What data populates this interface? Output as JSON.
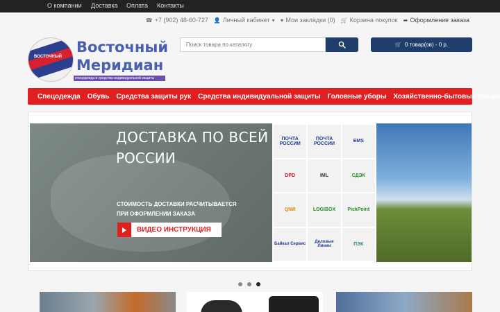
{
  "top_nav": {
    "items": [
      "О компании",
      "Доставка",
      "Оплата",
      "Контакты"
    ]
  },
  "utility": {
    "phone": "+7 (902) 48-60-727",
    "account": "Личный кабинет",
    "bookmarks": "Мои закладки (0)",
    "cart": "Корзина покупок",
    "checkout": "Оформление заказа"
  },
  "logo": {
    "line1": "Восточный",
    "line2": "Меридиан",
    "tagline": "спецодежда и средства индивидуальной защиты",
    "emblem_text": "ВОСТОЧНЫЙ"
  },
  "search": {
    "placeholder": "Поиск товара по каталогу"
  },
  "cart_button": {
    "label": "0 товар(ов) - 0 р."
  },
  "main_nav": {
    "items": [
      "Спецодежда",
      "Обувь",
      "Средства защиты рук",
      "Средства индивидуальной защиты",
      "Головные уборы",
      "Хозяйственно-бытовые товары"
    ]
  },
  "slider": {
    "heading_line1": "ДОСТАВКА ПО ВСЕЙ",
    "heading_line2": "РОССИИ",
    "sub_line1": "СТОИМОСТЬ ДОСТАВКИ РАСЧИТЫВАЕТСЯ",
    "sub_line2": "ПРИ ОФОРМЛЕНИИ ЗАКАЗА",
    "video_label": "ВИДЕО ИНСТРУКЦИЯ",
    "carriers": [
      "ПОЧТА РОССИИ",
      "ПОЧТА РОССИИ",
      "EMS",
      "DPD",
      "IML",
      "СДЭК",
      "QIWI",
      "LOGIBOX",
      "PickPoint",
      "Байкал Сервис",
      "Деловые Линии",
      "ПЭК"
    ],
    "active_slide": 3,
    "slide_count": 3
  },
  "colors": {
    "accent_red": "#e02020",
    "navy": "#1f3d6b",
    "logo_blue": "#4a5fb0"
  }
}
